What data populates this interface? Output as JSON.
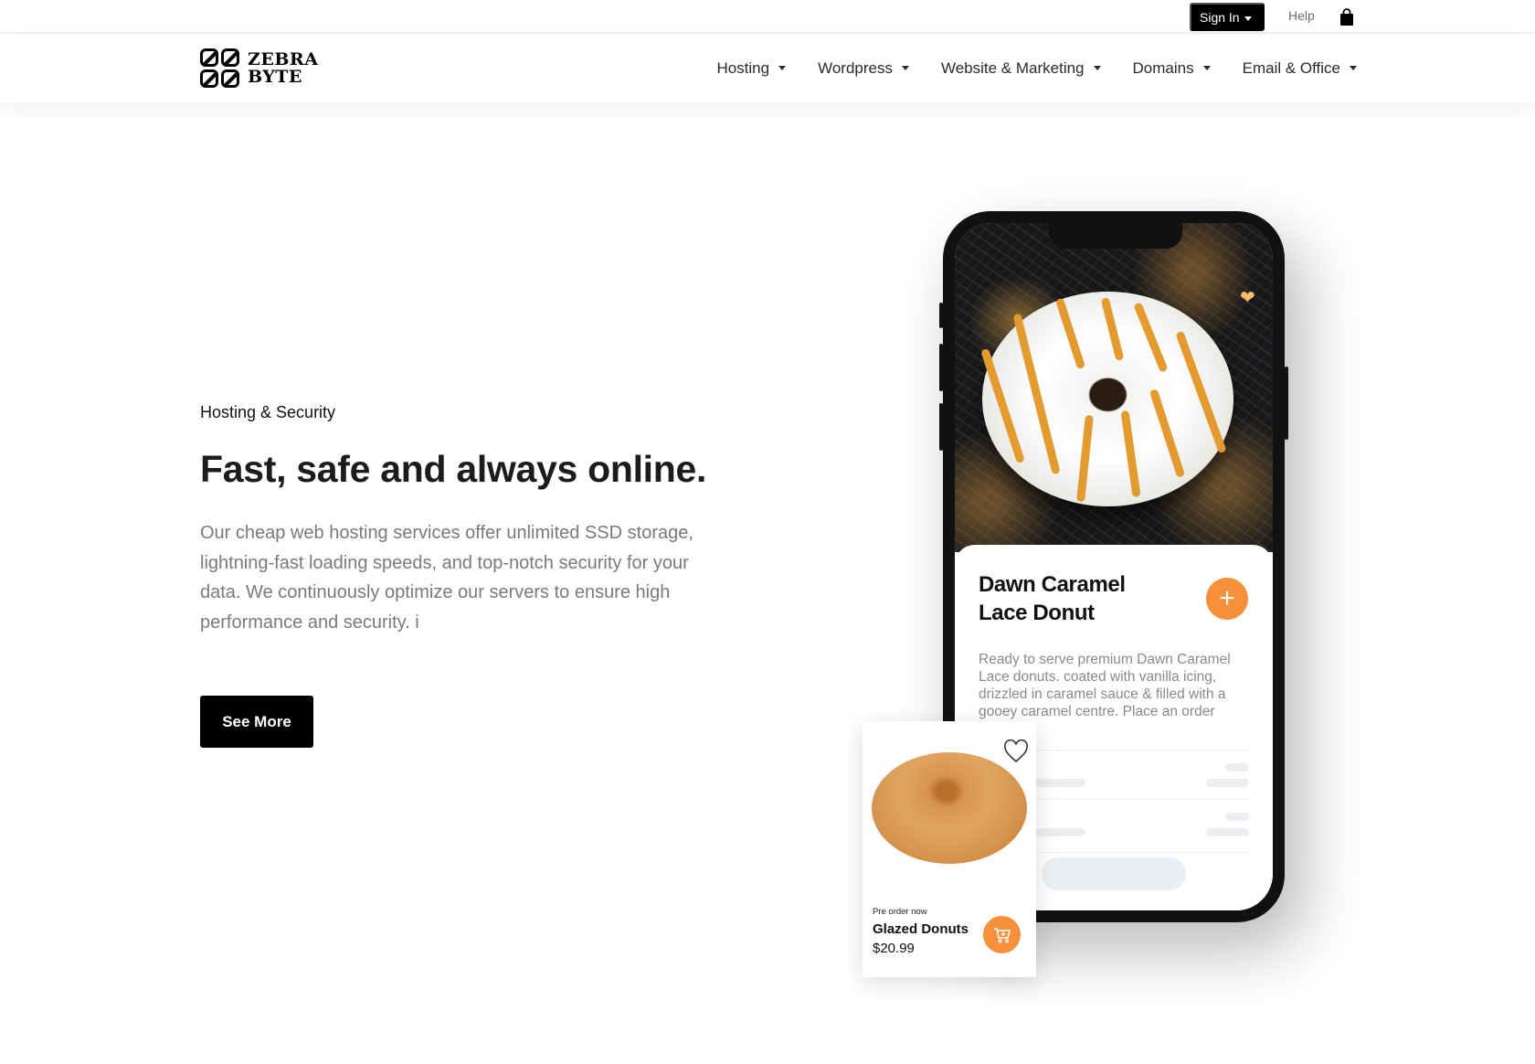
{
  "topbar": {
    "sign_in_label": "Sign In",
    "help_label": "Help",
    "bag_icon": "shopping-bag-icon"
  },
  "brand": {
    "line1": "ZEBRA",
    "line2": "BYTE"
  },
  "nav": {
    "items": [
      {
        "label": "Hosting"
      },
      {
        "label": "Wordpress"
      },
      {
        "label": "Website & Marketing"
      },
      {
        "label": "Domains"
      },
      {
        "label": "Email & Office"
      }
    ]
  },
  "hero": {
    "eyebrow": "Hosting & Security",
    "headline": "Fast, safe and always online.",
    "description": "Our cheap web hosting services offer unlimited SSD storage, lightning-fast loading speeds, and top-notch security for your data. We continuously optimize our servers to ensure high performance and security. i",
    "cta_label": "See More"
  },
  "phone_mockup": {
    "product_title": "Dawn Caramel Lace Donut",
    "product_description": "Ready to serve premium Dawn Caramel Lace donuts. coated with vanilla icing, drizzled in caramel sauce & filled with a gooey caramel centre. Place an order",
    "add_button_symbol": "+"
  },
  "mini_card": {
    "caption": "Pre order now",
    "title": "Glazed Donuts",
    "price": "$20.99"
  },
  "colors": {
    "accent_orange": "#f7903b",
    "primary_black": "#000000",
    "muted_text": "#7a7a7a"
  }
}
